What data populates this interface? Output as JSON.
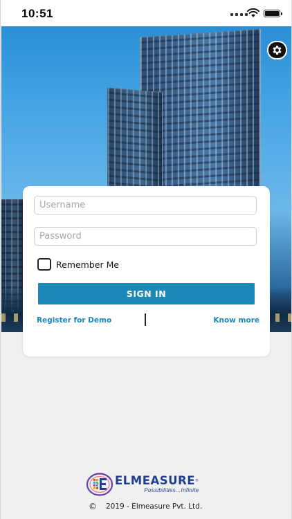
{
  "status_bar": {
    "time": "10:51"
  },
  "hero": {
    "settings_icon": "gear-icon"
  },
  "login": {
    "username_placeholder": "Username",
    "password_placeholder": "Password",
    "remember_label": "Remember Me",
    "remember_checked": false,
    "signin_label": "SIGN IN",
    "register_label": "Register for Demo",
    "know_more_label": "Know more"
  },
  "footer": {
    "brand_name": "ELMEASURE",
    "tagline": "Possibilities...Infinite",
    "copyright_symbol": "©",
    "copyright_text": "2019 - Elmeasure Pvt. Ltd."
  },
  "colors": {
    "accent": "#1b88b8",
    "brand": "#1f3f8f",
    "background": "#f0f0f0"
  }
}
